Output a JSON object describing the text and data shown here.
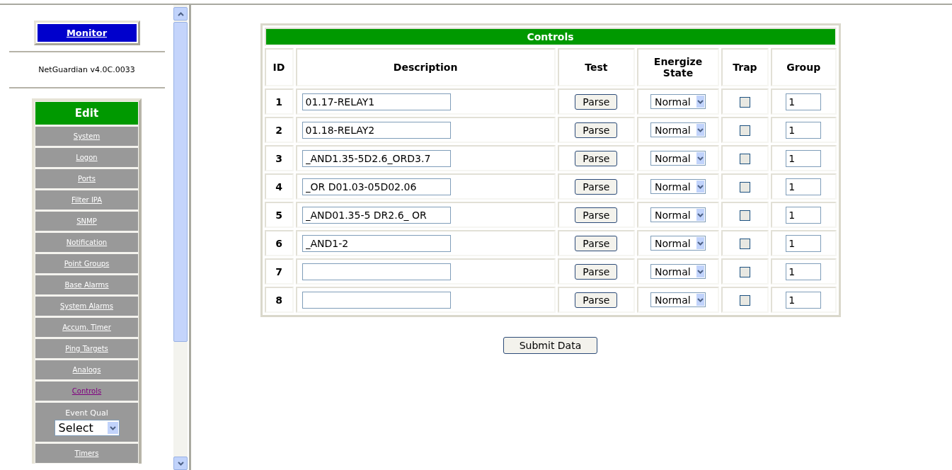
{
  "sidebar": {
    "monitor": "Monitor",
    "version": "NetGuardian v4.0C.0033",
    "edit_header": "Edit",
    "items": [
      {
        "kind": "link",
        "label": "System",
        "selected": false
      },
      {
        "kind": "link",
        "label": "Logon",
        "selected": false
      },
      {
        "kind": "link",
        "label": "Ports",
        "selected": false
      },
      {
        "kind": "link",
        "label": "Filter IPA",
        "selected": false
      },
      {
        "kind": "link",
        "label": "SNMP",
        "selected": false
      },
      {
        "kind": "link",
        "label": "Notification",
        "selected": false
      },
      {
        "kind": "link",
        "label": "Point Groups",
        "selected": false
      },
      {
        "kind": "link",
        "label": "Base Alarms",
        "selected": false
      },
      {
        "kind": "link",
        "label": "System Alarms",
        "selected": false
      },
      {
        "kind": "link",
        "label": "Accum. Timer",
        "selected": false
      },
      {
        "kind": "link",
        "label": "Ping Targets",
        "selected": false
      },
      {
        "kind": "link",
        "label": "Analogs",
        "selected": false
      },
      {
        "kind": "link",
        "label": "Controls",
        "selected": true
      },
      {
        "kind": "select",
        "label": "Event Qual",
        "value": "Select"
      },
      {
        "kind": "link",
        "label": "Timers",
        "selected": false
      }
    ]
  },
  "table": {
    "title": "Controls",
    "columns": [
      "ID",
      "Description",
      "Test",
      "Energize State",
      "Trap",
      "Group"
    ],
    "rows": [
      {
        "id": "1",
        "description": "01.17-RELAY1",
        "test": "Parse",
        "state": "Normal",
        "trap": false,
        "group": "1"
      },
      {
        "id": "2",
        "description": "01.18-RELAY2",
        "test": "Parse",
        "state": "Normal",
        "trap": false,
        "group": "1"
      },
      {
        "id": "3",
        "description": "_AND1.35-5D2.6_ORD3.7",
        "test": "Parse",
        "state": "Normal",
        "trap": false,
        "group": "1"
      },
      {
        "id": "4",
        "description": "_OR D01.03-05D02.06",
        "test": "Parse",
        "state": "Normal",
        "trap": false,
        "group": "1"
      },
      {
        "id": "5",
        "description": "_AND01.35-5 DR2.6_ OR",
        "test": "Parse",
        "state": "Normal",
        "trap": false,
        "group": "1"
      },
      {
        "id": "6",
        "description": "_AND1-2",
        "test": "Parse",
        "state": "Normal",
        "trap": false,
        "group": "1"
      },
      {
        "id": "7",
        "test": "Parse",
        "state": "Normal",
        "trap": false,
        "group": "1"
      },
      {
        "id": "8",
        "test": "Parse",
        "state": "Normal",
        "trap": false,
        "group": "1"
      }
    ]
  },
  "submit": "Submit Data"
}
